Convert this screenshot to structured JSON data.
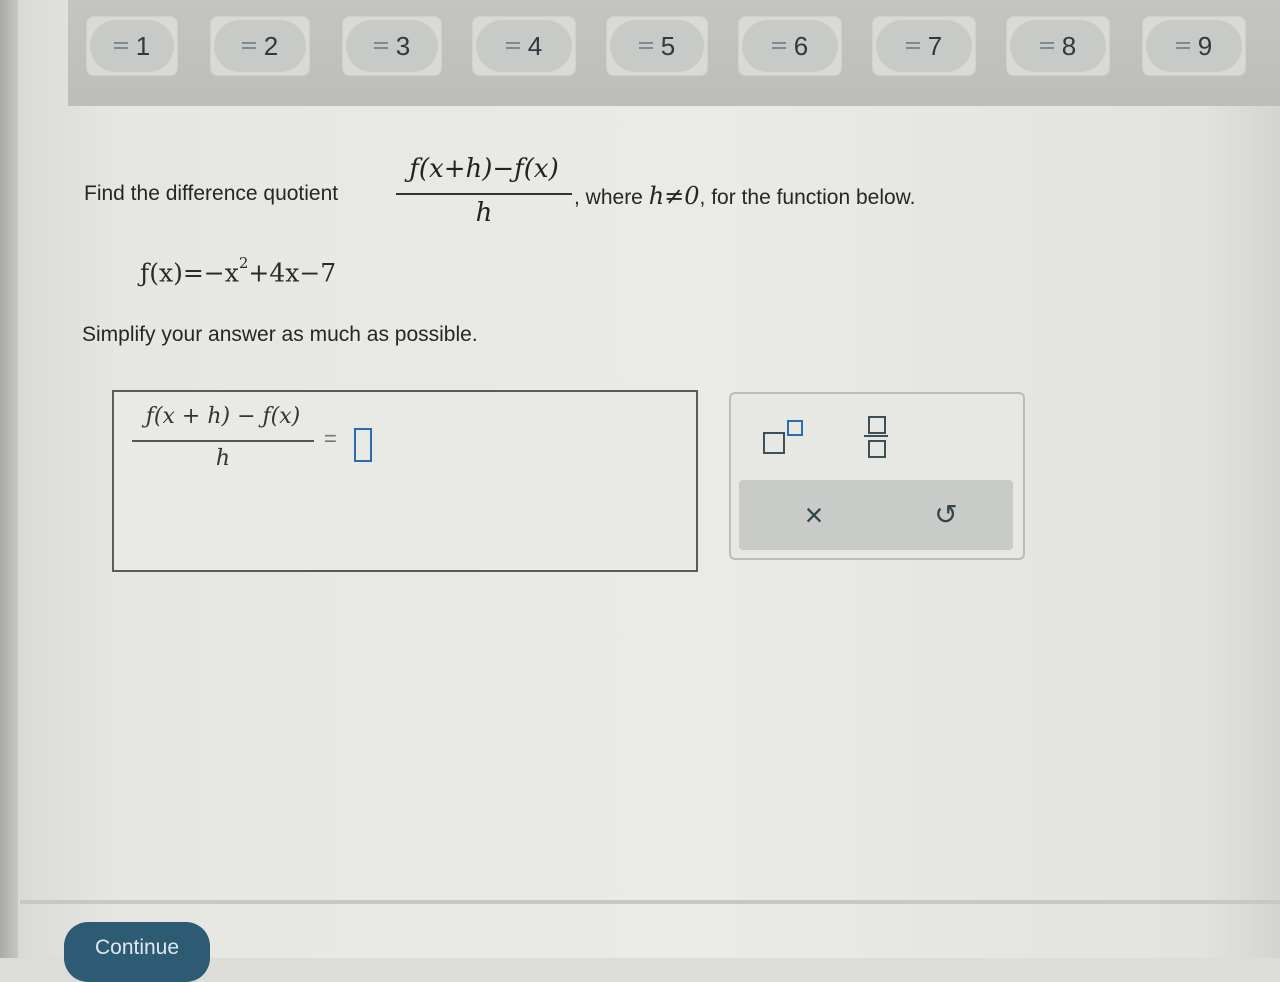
{
  "question_nav": [
    {
      "label": "1"
    },
    {
      "label": "2"
    },
    {
      "label": "3"
    },
    {
      "label": "4"
    },
    {
      "label": "5"
    },
    {
      "label": "6"
    },
    {
      "label": "7"
    },
    {
      "label": "8"
    },
    {
      "label": "9"
    }
  ],
  "problem": {
    "prefix": "Find the difference quotient",
    "quotient_numerator": "ƒ(x+h)−ƒ(x)",
    "quotient_denominator": "h",
    "suffix_before": ", where ",
    "suffix_condition": "h≠0",
    "suffix_after": ", for the function below.",
    "function_lhs": "ƒ(x)=−x",
    "function_exponent": "2",
    "function_rhs": "+4x−7",
    "instruction": "Simplify your answer as much as possible."
  },
  "answer": {
    "numerator": "ƒ(x + h) − ƒ(x)",
    "denominator": "h",
    "equals": "=",
    "value": ""
  },
  "palette": {
    "superscript_icon": "superscript-icon",
    "fraction_icon": "fraction-icon",
    "clear_label": "×",
    "undo_label": "↺"
  },
  "footer": {
    "continue_label": "Continue"
  },
  "colors": {
    "accent": "#2b6cb0",
    "continue_bg": "#2d5b73"
  }
}
